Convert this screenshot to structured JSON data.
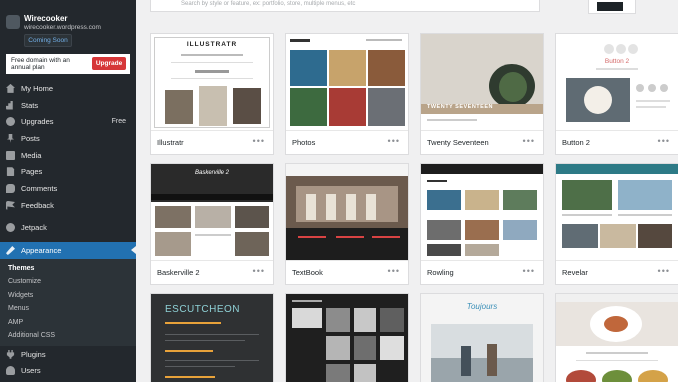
{
  "site": {
    "title": "Wirecooker",
    "url": "wirecooker.wordpress.com",
    "status_badge": "Coming Soon"
  },
  "promo": {
    "text": "Free domain with an annual plan",
    "button": "Upgrade"
  },
  "menu": {
    "home": "My Home",
    "stats": "Stats",
    "upgrades": "Upgrades",
    "upgrades_badge": "Free",
    "posts": "Posts",
    "media": "Media",
    "pages": "Pages",
    "comments": "Comments",
    "feedback": "Feedback",
    "jetpack": "Jetpack",
    "appearance": "Appearance",
    "plugins": "Plugins",
    "users": "Users"
  },
  "submenu": {
    "themes": "Themes",
    "customize": "Customize",
    "widgets": "Widgets",
    "menus": "Menus",
    "amp": "AMP",
    "additional_css": "Additional CSS"
  },
  "search": {
    "partial_text": "Search by style or feature, ex: portfolio, store, multiple menus, etc"
  },
  "themes": {
    "illustratr": "Illustratr",
    "photos": "Photos",
    "twenty_seventeen": "Twenty Seventeen",
    "button2": "Button 2",
    "baskerville2": "Baskerville 2",
    "textbook": "TextBook",
    "rowling": "Rowling",
    "revelar": "Revelar",
    "more": "•••"
  },
  "preview_text": {
    "illustratr_logo": "ILLUSTRATR",
    "button_logo": "Button 2",
    "twenty_seventeen_caption": "TWENTY SEVENTEEN",
    "baskerville_logo": "Baskerville 2",
    "escutcheon_logo": "ESCUTCHEON",
    "toujours_logo": "Toujours"
  },
  "colors": {
    "sidebar": "#23282d",
    "accent": "#2271b1",
    "upgrade": "#d63638"
  }
}
